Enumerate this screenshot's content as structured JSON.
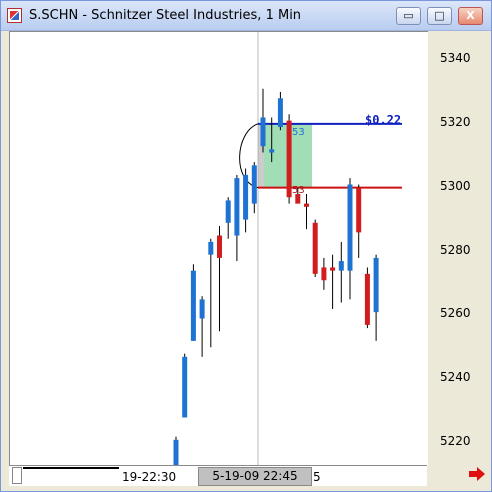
{
  "window": {
    "title": "S.SCHN - Schnitzer Steel Industries, 1 Min",
    "buttons": {
      "minimize": "▭",
      "maximize": "□",
      "close": "X"
    }
  },
  "chart": {
    "price_labels": [
      "5340",
      "5320",
      "5300",
      "5280",
      "5260",
      "5240",
      "5220"
    ],
    "annotation_price": "$0.22",
    "box_top_label": "53",
    "box_bottom_label": "53",
    "colors": {
      "up": "#1e73d2",
      "down": "#d11d1d",
      "box": "#8ad6a4",
      "blueline": "#1020c0",
      "redline": "#cc1010"
    }
  },
  "timeline": {
    "left_time": "19-22:30",
    "current_time": "5-19-09 22:45",
    "tail_time": "5"
  },
  "chart_data": {
    "type": "candlestick",
    "y_ticks": [
      5220,
      5240,
      5260,
      5280,
      5300,
      5320,
      5340
    ],
    "ylim": [
      5210,
      5351
    ],
    "candles": [
      {
        "o": 5212,
        "h": 5222,
        "l": 5212,
        "c": 5221
      },
      {
        "o": 5228,
        "h": 5248,
        "l": 5228,
        "c": 5247
      },
      {
        "o": 5252,
        "h": 5276,
        "l": 5252,
        "c": 5274
      },
      {
        "o": 5259,
        "h": 5266,
        "l": 5247,
        "c": 5265
      },
      {
        "o": 5279,
        "h": 5284,
        "l": 5250,
        "c": 5283
      },
      {
        "o": 5285,
        "h": 5288,
        "l": 5255,
        "c": 5278
      },
      {
        "o": 5289,
        "h": 5297,
        "l": 5284,
        "c": 5296
      },
      {
        "o": 5285,
        "h": 5304,
        "l": 5277,
        "c": 5303
      },
      {
        "o": 5290,
        "h": 5306,
        "l": 5286,
        "c": 5304
      },
      {
        "o": 5295,
        "h": 5308,
        "l": 5292,
        "c": 5307
      },
      {
        "o": 5313,
        "h": 5331,
        "l": 5311,
        "c": 5322
      },
      {
        "o": 5311,
        "h": 5322,
        "l": 5308,
        "c": 5312
      },
      {
        "o": 5319,
        "h": 5330,
        "l": 5318,
        "c": 5328
      },
      {
        "o": 5321,
        "h": 5323,
        "l": 5295,
        "c": 5297
      },
      {
        "o": 5298,
        "h": 5300,
        "l": 5296,
        "c": 5295
      },
      {
        "o": 5295,
        "h": 5298,
        "l": 5287,
        "c": 5294
      },
      {
        "o": 5289,
        "h": 5290,
        "l": 5272,
        "c": 5273
      },
      {
        "o": 5275,
        "h": 5278,
        "l": 5268,
        "c": 5271
      },
      {
        "o": 5275,
        "h": 5279,
        "l": 5262,
        "c": 5274
      },
      {
        "o": 5274,
        "h": 5283,
        "l": 5264,
        "c": 5277
      },
      {
        "o": 5274,
        "h": 5303,
        "l": 5265,
        "c": 5301
      },
      {
        "o": 5300,
        "h": 5301,
        "l": 5278,
        "c": 5286
      },
      {
        "o": 5273,
        "h": 5275,
        "l": 5256,
        "c": 5257
      },
      {
        "o": 5261,
        "h": 5279,
        "l": 5252,
        "c": 5278
      }
    ],
    "box_top": 5320,
    "box_bottom": 5300
  }
}
